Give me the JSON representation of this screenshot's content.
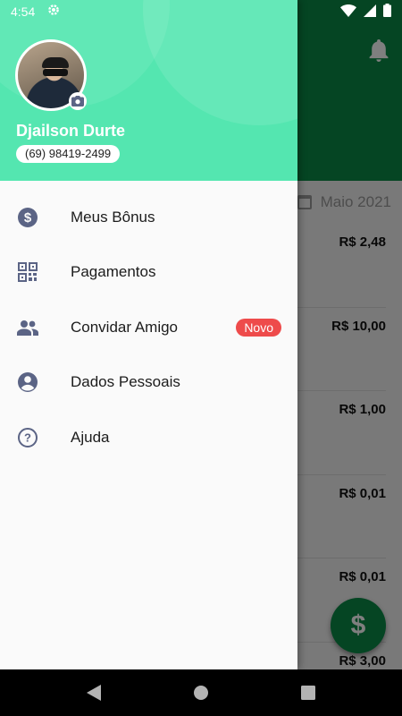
{
  "status_bar": {
    "time": "4:54",
    "icons": [
      "settings-icon",
      "wifi-icon",
      "signal-icon",
      "battery-icon"
    ]
  },
  "background_app": {
    "month_filter": "Maio 2021",
    "amounts": [
      "R$ 2,48",
      "R$ 10,00",
      "R$ 1,00",
      "R$ 0,01",
      "R$ 0,01",
      "R$ 3,00"
    ],
    "fab_symbol": "$",
    "colors": {
      "header": "#0a8a46",
      "fab": "#0a8a46"
    }
  },
  "drawer": {
    "user": {
      "name": "Djailson Durte",
      "phone": "(69) 98419-2499"
    },
    "items": [
      {
        "label": "Meus Bônus",
        "icon": "dollar-circle-icon"
      },
      {
        "label": "Pagamentos",
        "icon": "qr-code-icon"
      },
      {
        "label": "Convidar Amigo",
        "icon": "people-icon",
        "badge": "Novo"
      },
      {
        "label": "Dados Pessoais",
        "icon": "account-circle-icon"
      },
      {
        "label": "Ajuda",
        "icon": "help-circle-icon"
      }
    ],
    "colors": {
      "header": "#54e6b0",
      "icon": "#5b6485",
      "badge": "#ee4b4b"
    }
  },
  "nav_bar": {
    "buttons": [
      "back-icon",
      "home-icon",
      "recents-icon"
    ]
  }
}
